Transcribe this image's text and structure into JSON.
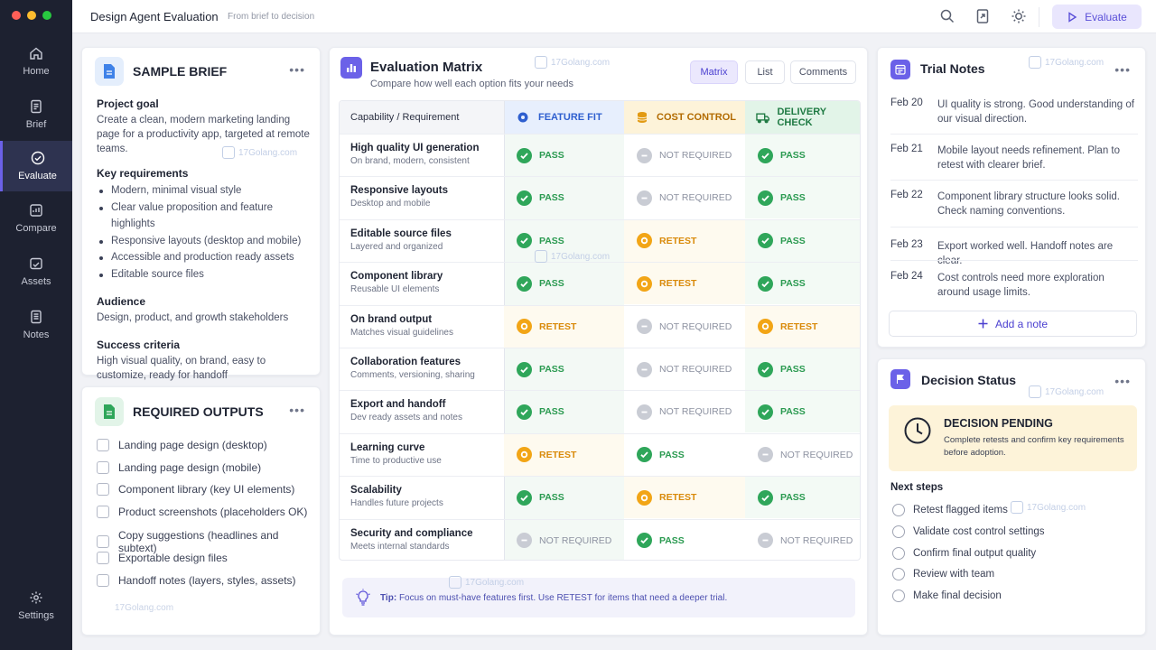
{
  "app": {
    "title": "Design Agent Evaluation",
    "subtitle": "From brief to decision",
    "evaluate_label": "Evaluate"
  },
  "sidebar": {
    "items": [
      {
        "label": "Home",
        "icon": "home-icon"
      },
      {
        "label": "Brief",
        "icon": "document-icon"
      },
      {
        "label": "Evaluate",
        "icon": "check-circle-icon"
      },
      {
        "label": "Compare",
        "icon": "compare-icon"
      },
      {
        "label": "Assets",
        "icon": "folder-icon"
      },
      {
        "label": "Notes",
        "icon": "notes-icon"
      },
      {
        "label": "Settings",
        "icon": "gear-icon"
      }
    ]
  },
  "brief": {
    "title": "SAMPLE BRIEF",
    "goal_heading": "Project goal",
    "goal_text": "Create a clean, modern marketing landing page for a productivity app, targeted at remote teams.",
    "req_heading": "Key requirements",
    "requirements": [
      "Modern, minimal visual style",
      "Clear value proposition and feature highlights",
      "Responsive layouts (desktop and mobile)",
      "Accessible and production ready assets",
      "Editable source files"
    ],
    "audience_heading": "Audience",
    "audience_text": "Design, product, and growth stakeholders",
    "success_heading": "Success criteria",
    "success_text": "High visual quality, on brand, easy to customize, ready for handoff"
  },
  "outputs": {
    "title": "REQUIRED OUTPUTS",
    "items": [
      "Landing page design (desktop)",
      "Landing page design (mobile)",
      "Component library (key UI elements)",
      "Product screenshots (placeholders OK)",
      "Copy suggestions (headlines and subtext)",
      "Exportable design files",
      "Handoff notes (layers, styles, assets)"
    ]
  },
  "matrix": {
    "title": "Evaluation Matrix",
    "subtitle": "Compare how well each option fits your needs",
    "views": [
      "Matrix",
      "List",
      "Comments"
    ],
    "header_req": "Capability / Requirement",
    "columns": [
      {
        "label": "FEATURE FIT",
        "icon": "gear-icon"
      },
      {
        "label": "COST CONTROL",
        "icon": "coins-icon"
      },
      {
        "label": "DELIVERY CHECK",
        "icon": "truck-icon"
      }
    ],
    "status_labels": {
      "pass": "PASS",
      "retest": "RETEST",
      "notreq": "NOT REQUIRED"
    },
    "rows": [
      {
        "title": "High quality UI generation",
        "sub": "On brand, modern, consistent",
        "status": [
          "pass",
          "notreq",
          "pass"
        ]
      },
      {
        "title": "Responsive layouts",
        "sub": "Desktop and mobile",
        "status": [
          "pass",
          "notreq",
          "pass"
        ]
      },
      {
        "title": "Editable source files",
        "sub": "Layered and organized",
        "status": [
          "pass",
          "retest",
          "pass"
        ]
      },
      {
        "title": "Component library",
        "sub": "Reusable UI elements",
        "status": [
          "pass",
          "retest",
          "pass"
        ]
      },
      {
        "title": "On brand output",
        "sub": "Matches visual guidelines",
        "status": [
          "retest",
          "notreq",
          "retest"
        ]
      },
      {
        "title": "Collaboration features",
        "sub": "Comments, versioning, sharing",
        "status": [
          "pass",
          "notreq",
          "pass"
        ]
      },
      {
        "title": "Export and handoff",
        "sub": "Dev ready assets and notes",
        "status": [
          "pass",
          "notreq",
          "pass"
        ]
      },
      {
        "title": "Learning curve",
        "sub": "Time to productive use",
        "status": [
          "retest",
          "pass",
          "notreq"
        ]
      },
      {
        "title": "Scalability",
        "sub": "Handles future projects",
        "status": [
          "pass",
          "retest",
          "pass"
        ]
      },
      {
        "title": "Security and compliance",
        "sub": "Meets internal standards",
        "status": [
          "notreq",
          "pass",
          "notreq"
        ]
      }
    ],
    "tip_label": "Tip:",
    "tip_text": "Focus on must-have features first. Use RETEST for items that need a deeper trial."
  },
  "notes": {
    "title": "Trial Notes",
    "items": [
      {
        "date": "Feb 20",
        "text": "UI quality is strong. Good understanding of our visual direction."
      },
      {
        "date": "Feb 21",
        "text": "Mobile layout needs refinement. Plan to retest with clearer brief."
      },
      {
        "date": "Feb 22",
        "text": "Component library structure looks solid. Check naming conventions."
      },
      {
        "date": "Feb 23",
        "text": "Export worked well. Handoff notes are clear."
      },
      {
        "date": "Feb 24",
        "text": "Cost controls need more exploration around usage limits."
      }
    ],
    "add_label": "Add a note"
  },
  "decision": {
    "title": "Decision Status",
    "status": "DECISION PENDING",
    "status_text": "Complete retests and confirm key requirements before adoption.",
    "steps_heading": "Next steps",
    "steps": [
      "Retest flagged items",
      "Validate cost control settings",
      "Confirm final output quality",
      "Review with team",
      "Make final decision"
    ]
  },
  "watermark": "17Golang.com",
  "colors": {
    "accent": "#6b61e8",
    "pass": "#2fa65a",
    "retest": "#f2a516",
    "notreq": "#c9ccd4",
    "sidebar": "#1d2130"
  }
}
